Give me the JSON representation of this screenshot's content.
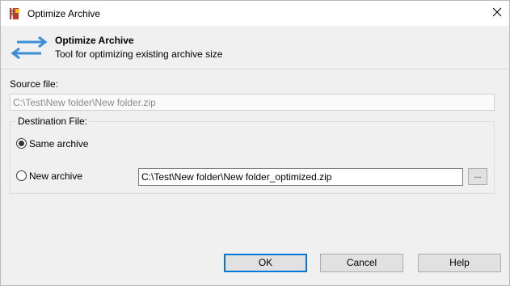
{
  "window": {
    "title": "Optimize Archive",
    "close_glyph": "✕"
  },
  "header": {
    "title": "Optimize Archive",
    "subtitle": "Tool for optimizing existing archive size",
    "icon": "swap-arrows-icon",
    "icon_color": "#3c8fd6"
  },
  "source": {
    "label": "Source file:",
    "value": "C:\\Test\\New folder\\New folder.zip"
  },
  "destination": {
    "label": "Destination File:",
    "options": [
      {
        "label": "Same archive",
        "checked": true
      },
      {
        "label": "New archive",
        "checked": false
      }
    ],
    "new_archive_path": "C:\\Test\\New folder\\New folder_optimized.zip",
    "browse_label": "..."
  },
  "buttons": {
    "ok": "OK",
    "cancel": "Cancel",
    "help": "Help"
  },
  "colors": {
    "accent": "#0078d7",
    "app_icon": "#c0392b"
  }
}
